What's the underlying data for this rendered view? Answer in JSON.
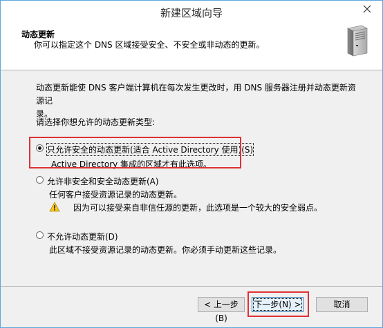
{
  "window": {
    "title": "新建区域向导"
  },
  "header": {
    "title": "动态更新",
    "subtitle": "你可以指定这个 DNS 区域接受安全、不安全或非动态的更新。"
  },
  "body": {
    "description_line1": "动态更新能使 DNS 客户端计算机在每次发生更改时，用 DNS 服务器注册并动态更新资源记",
    "description_line2": "录。",
    "prompt": "请选择你想允许的动态更新类型:",
    "options": [
      {
        "label": "只允许安全的动态更新(适合 Active Directory 使用)(S)",
        "description": "Active Directory 集成的区域才有此选项。",
        "selected": true
      },
      {
        "label": "允许非安全和安全动态更新(A)",
        "description": "任何客户接受资源记录的动态更新。",
        "warning": "因为可以接受来自非信任源的更新，此选项是一个较大的安全弱点。",
        "selected": false
      },
      {
        "label": "不允许动态更新(D)",
        "description": "此区域不接受资源记录的动态更新。你必须手动更新这些记录。",
        "selected": false
      }
    ]
  },
  "buttons": {
    "back": "< 上一步(B)",
    "next": "下一步(N) >",
    "cancel": "取消"
  },
  "colors": {
    "highlight": "#e03034",
    "window_border": "#5aa8dc"
  }
}
